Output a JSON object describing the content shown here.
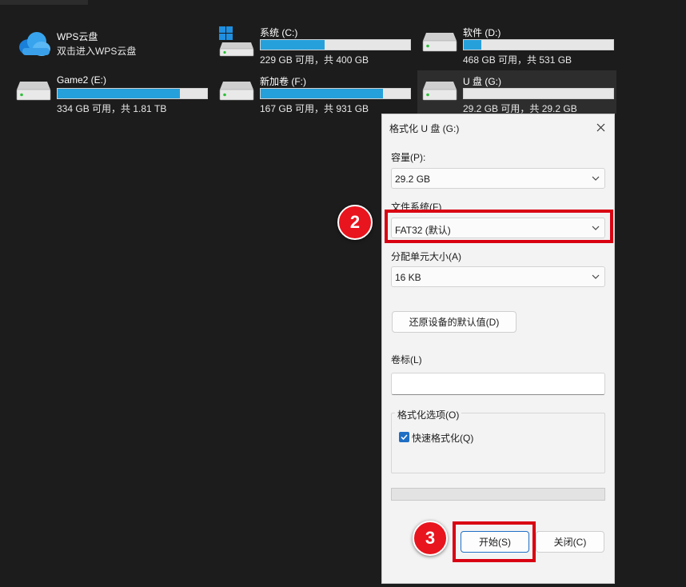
{
  "drives": [
    {
      "name": "WPS云盘",
      "subtitle": "双击进入WPS云盘",
      "icon": "cloud-icon"
    },
    {
      "name": "系统 (C:)",
      "size": "229 GB 可用，共 400 GB",
      "used_fraction": 0.43,
      "icon": "windows-drive-icon"
    },
    {
      "name": "软件 (D:)",
      "size": "468 GB 可用，共 531 GB",
      "used_fraction": 0.12,
      "icon": "hard-drive-icon"
    },
    {
      "name": "Game2 (E:)",
      "size": "334 GB 可用，共 1.81 TB",
      "used_fraction": 0.82,
      "icon": "hard-drive-icon"
    },
    {
      "name": "新加卷 (F:)",
      "size": "167 GB 可用，共 931 GB",
      "used_fraction": 0.82,
      "icon": "hard-drive-icon"
    },
    {
      "name": "U 盘 (G:)",
      "size": "29.2 GB 可用，共 29.2 GB",
      "used_fraction": 0.0,
      "icon": "usb-drive-icon"
    }
  ],
  "dialog": {
    "title": "格式化 U 盘 (G:)",
    "capacity_label": "容量(P):",
    "capacity_value": "29.2 GB",
    "filesystem_label": "文件系统(F)",
    "filesystem_value": "FAT32 (默认)",
    "allocation_label": "分配单元大小(A)",
    "allocation_value": "16 KB",
    "restore_button": "还原设备的默认值(D)",
    "volume_label": "卷标(L)",
    "volume_value": "",
    "options_label": "格式化选项(O)",
    "quick_format_label": "快速格式化(Q)",
    "quick_format_checked": true,
    "progress": 0,
    "start_button": "开始(S)",
    "close_button": "关闭(C)"
  },
  "annotations": {
    "step2": "2",
    "step3": "3",
    "highlight_color": "#d90012"
  },
  "colors": {
    "accent": "#26a0da",
    "checkbox": "#1f6fc5",
    "background": "#1c1c1c"
  }
}
